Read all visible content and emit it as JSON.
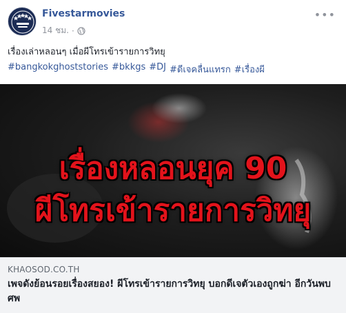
{
  "post": {
    "page_name": "Fivestarmovies",
    "time": "14 ชม.",
    "separator": "·",
    "privacy_icon": "globe-icon",
    "more_icon": "ellipsis-icon",
    "caption": "เรื่องเล่าหลอนๆ เมื่อผีโทรเข้ารายการวิทยุ",
    "hashtags": [
      "#bangkokghoststories",
      "#bkkgs",
      "#DJ",
      "#ดีเจคลื่นแทรก",
      "#เรื่องผี"
    ]
  },
  "media": {
    "title_line1": "เรื่องหลอนยุค 90",
    "title_line2": "ผีโทรเข้ารายการวิทยุ",
    "title_color": "#e3131b"
  },
  "link": {
    "domain": "KHAOSOD.CO.TH",
    "title": "เพจดังย้อนรอยเรื่องสยอง! ผีโทรเข้ารายการวิทยุ บอกดีเจตัวเองถูกฆ่า อีกวันพบศพ"
  },
  "colors": {
    "page_name": "#365899",
    "hashtag": "#365899",
    "meta": "#90949c",
    "link_bg": "#f2f3f5"
  }
}
